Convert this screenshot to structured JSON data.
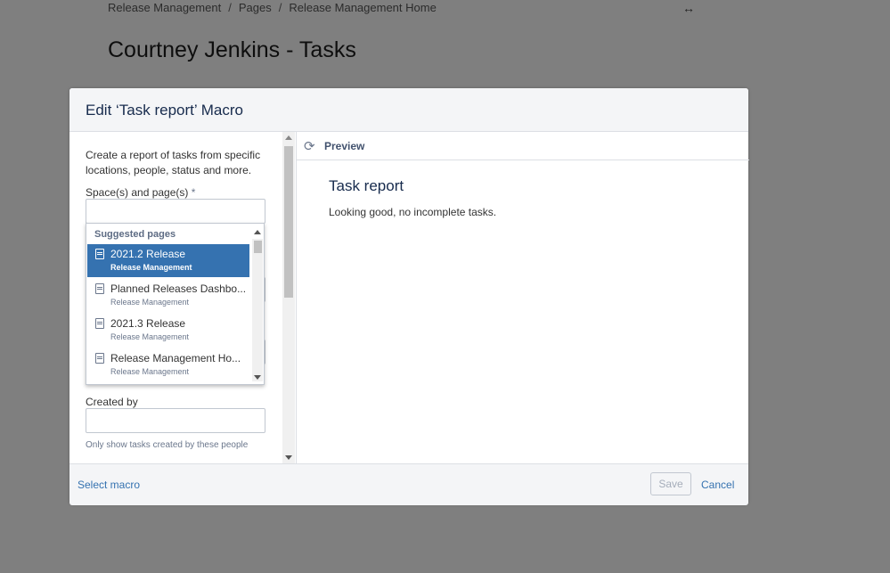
{
  "breadcrumb": [
    "Release Management",
    "Pages",
    "Release Management Home"
  ],
  "breadcrumb_separator": "/",
  "expand_glyph": "↔",
  "page_title": "Courtney Jenkins - Tasks",
  "dialog": {
    "title": "Edit ‘Task report’ Macro",
    "description": "Create a report of tasks from specific locations, people, status and more.",
    "spaces_label": "Space(s) and page(s)",
    "required_mark": "*",
    "suggest": {
      "heading": "Suggested pages",
      "items": [
        {
          "title": "2021.2 Release",
          "space": "Release Management",
          "selected": true
        },
        {
          "title": "Planned Releases Dashbo...",
          "space": "Release Management",
          "selected": false
        },
        {
          "title": "2021.3 Release",
          "space": "Release Management",
          "selected": false
        },
        {
          "title": "Release Management Ho...",
          "space": "Release Management",
          "selected": false
        }
      ]
    },
    "created_by_label": "Created by",
    "created_by_hint": "Only show tasks created by these people",
    "preview": {
      "label": "Preview",
      "report_title": "Task report",
      "message": "Looking good, no incomplete tasks."
    },
    "footer": {
      "select_macro": "Select macro",
      "save": "Save",
      "cancel": "Cancel"
    }
  },
  "colors": {
    "backdrop": "#7f7f7f",
    "selected_row": "#3572b0",
    "link": "#3572b0"
  }
}
